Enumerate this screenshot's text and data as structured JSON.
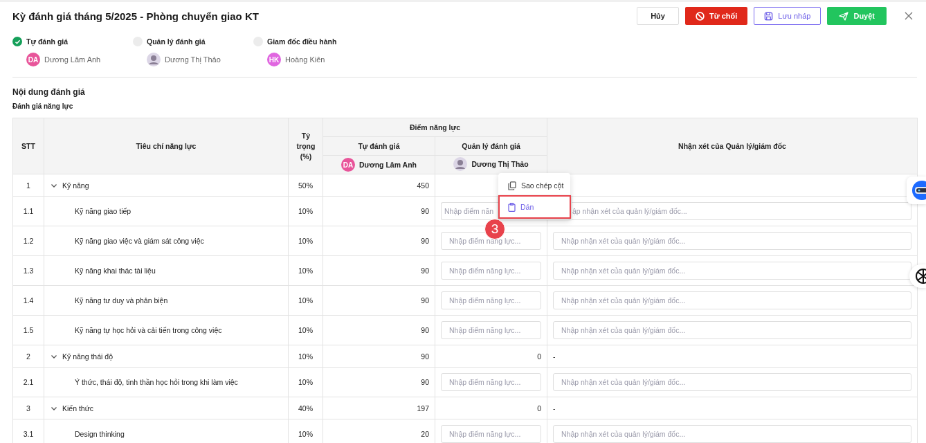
{
  "title": "Kỳ đánh giá tháng 5/2025 - Phòng chuyển giao KT",
  "actions": [
    {
      "kind": "cancel",
      "label": "Hủy"
    },
    {
      "kind": "reject",
      "label": "Từ chối"
    },
    {
      "kind": "draft",
      "label": "Lưu nháp"
    },
    {
      "kind": "approve",
      "label": "Duyệt"
    }
  ],
  "steps": [
    {
      "label": "Tự đánh giá",
      "done": true,
      "person": {
        "kind": "initials",
        "initials": "DA",
        "color": "#e8559a",
        "name": "Dương Lâm Anh"
      }
    },
    {
      "label": "Quản lý đánh giá",
      "done": false,
      "person": {
        "kind": "photo",
        "name": "Dương Thị Thảo"
      }
    },
    {
      "label": "Giam đốc điều hành",
      "done": false,
      "person": {
        "kind": "initials",
        "initials": "HK",
        "color": "#e066e0",
        "name": "Hoàng Kiên"
      }
    }
  ],
  "section_title": "Nội dung đánh giá",
  "subsection_title": "Đánh giá năng lực",
  "table": {
    "columns": {
      "index": "STT",
      "criteria": "Tiêu chí năng lực",
      "weight": "Tỷ trọng (%)",
      "score_group": "Điểm năng lực",
      "self": "Tự đánh giá",
      "manager": "Quản lý đánh giá",
      "comment": "Nhận xét của Quản lý/giám đốc"
    },
    "self_person": {
      "kind": "initials",
      "initials": "DA",
      "color": "#e8559a",
      "name": "Dương Lâm Anh"
    },
    "manager_person": {
      "kind": "photo",
      "name": "Dương Thị Thảo"
    },
    "rows": [
      {
        "index": "1",
        "criteria": "Kỹ năng",
        "weight": "50%",
        "self_score": "450",
        "expanded": true,
        "children": [
          {
            "index": "1.1",
            "criteria": "Kỹ năng giao tiếp",
            "weight": "10%",
            "self_score": "90",
            "score_placeholder": "Nhập điểm năn",
            "comment_placeholder": "ập nhận xét của quản lý/giám đốc..."
          },
          {
            "index": "1.2",
            "criteria": "Kỹ năng giao việc và giám sát công việc",
            "weight": "10%",
            "self_score": "90",
            "score_placeholder": "Nhập điểm năng lực...",
            "comment_placeholder": "Nhập nhận xét của quản lý/giám đốc..."
          },
          {
            "index": "1.3",
            "criteria": "Kỹ năng khai thác tài liệu",
            "weight": "10%",
            "self_score": "90",
            "score_placeholder": "Nhập điểm năng lực...",
            "comment_placeholder": "Nhập nhận xét của quản lý/giám đốc..."
          },
          {
            "index": "1.4",
            "criteria": "Kỹ năng tư duy và phản biện",
            "weight": "10%",
            "self_score": "90",
            "score_placeholder": "Nhập điểm năng lực...",
            "comment_placeholder": "Nhập nhận xét của quản lý/giám đốc..."
          },
          {
            "index": "1.5",
            "criteria": "Kỹ năng tự học hỏi và cải tiến trong công việc",
            "weight": "10%",
            "self_score": "90",
            "score_placeholder": "Nhập điểm năng lực...",
            "comment_placeholder": "Nhập nhận xét của quản lý/giám đốc..."
          }
        ]
      },
      {
        "index": "2",
        "criteria": "Kỹ năng thái độ",
        "weight": "10%",
        "self_score": "90",
        "manager_score": "0",
        "comment": "-",
        "expanded": true,
        "children": [
          {
            "index": "2.1",
            "criteria": "Ý thức, thái độ, tinh thần học hỏi trong khi làm việc",
            "weight": "10%",
            "self_score": "90",
            "score_placeholder": "Nhập điểm năng lực...",
            "comment_placeholder": "Nhập nhận xét của quản lý/giám đốc..."
          }
        ]
      },
      {
        "index": "3",
        "criteria": "Kiến thức",
        "weight": "40%",
        "self_score": "197",
        "manager_score": "0",
        "comment": "-",
        "expanded": true,
        "children": [
          {
            "index": "3.1",
            "criteria": "Design thinking",
            "weight": "10%",
            "self_score": "20",
            "score_placeholder": "Nhập điểm năng lực...",
            "comment_placeholder": "Nhập nhận xét của quản lý/giám đốc..."
          }
        ]
      }
    ]
  },
  "context_menu": {
    "items": [
      {
        "kind": "copy",
        "label": "Sao chép cột",
        "selected": false
      },
      {
        "kind": "paste",
        "label": "Dán",
        "selected": true
      }
    ],
    "step_badge": "3"
  }
}
